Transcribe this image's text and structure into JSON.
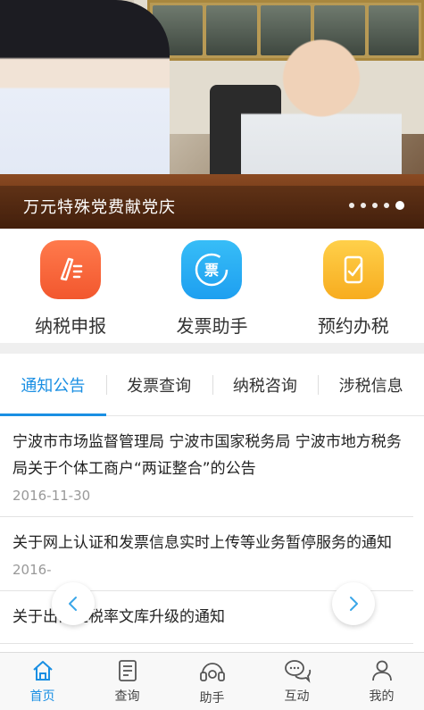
{
  "banner": {
    "caption": "万元特殊党费献党庆",
    "dots": 5,
    "active_dot": 5
  },
  "quick_actions": [
    {
      "label": "纳税申报",
      "icon": "pen-list-icon",
      "color": "#f2572e"
    },
    {
      "label": "发票助手",
      "icon": "invoice-ticket-icon",
      "color": "#1e9ff0",
      "icon_text": "票"
    },
    {
      "label": "预约办税",
      "icon": "phone-check-icon",
      "color": "#f7ac1f"
    }
  ],
  "tabs": [
    {
      "label": "通知公告",
      "active": true
    },
    {
      "label": "发票查询",
      "active": false
    },
    {
      "label": "纳税咨询",
      "active": false
    },
    {
      "label": "涉税信息",
      "active": false
    }
  ],
  "news": [
    {
      "title": "宁波市市场监督管理局 宁波市国家税务局 宁波市地方税务局关于个体工商户“两证整合”的公告",
      "date": "2016-11-30"
    },
    {
      "title": "关于网上认证和发票信息实时上传等业务暂停服务的通知",
      "date": "2016-"
    },
    {
      "title": "关于出口退税率文库升级的通知",
      "date": ""
    }
  ],
  "bottom_nav": [
    {
      "label": "首页",
      "icon": "home-icon",
      "active": true
    },
    {
      "label": "查询",
      "icon": "search-doc-icon",
      "active": false
    },
    {
      "label": "助手",
      "icon": "headset-icon",
      "active": false
    },
    {
      "label": "互动",
      "icon": "chat-bubbles-icon",
      "active": false
    },
    {
      "label": "我的",
      "icon": "user-icon",
      "active": false
    }
  ],
  "colors": {
    "accent": "#1a8fe3",
    "text": "#333333",
    "muted": "#999999"
  }
}
